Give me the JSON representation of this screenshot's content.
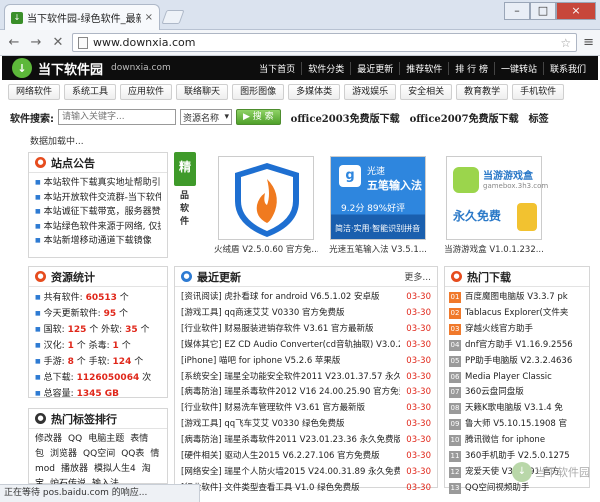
{
  "browser": {
    "tab_title": "当下软件园-绿色软件_最新",
    "tab_close": "×",
    "window_controls": [
      "–",
      "□",
      "×"
    ],
    "url": "www.downxia.com",
    "status_text": "正在等待 pos.baidu.com 的响应..."
  },
  "site": {
    "logo_text": "当下软件园",
    "logo_domain": "downxia.com",
    "top_nav": [
      "当下首页",
      "软件分类",
      "最近更新",
      "推荐软件",
      "排 行 榜",
      "一键转站",
      "联系我们"
    ],
    "categories": [
      "网络软件",
      "系统工具",
      "应用软件",
      "联络聊天",
      "图形图像",
      "多媒体类",
      "游戏娱乐",
      "安全相关",
      "教育教学",
      "手机软件"
    ],
    "search": {
      "label": "软件搜索:",
      "placeholder": "请输入关键字...",
      "select_value": "资源名称",
      "button": "搜 索",
      "hot_links": [
        "office2003免费版下载",
        "office2007免费版下载",
        "标签"
      ]
    },
    "loading_text": "数据加载中..."
  },
  "notice": {
    "title": "站点公告",
    "items": [
      "本站软件下载真实地址帮助引导",
      "本站开放软件交流群-当下软件园",
      "本站诚征下载带宽，服务器赞助",
      "本站绿色软件来源于网络, 仅提供",
      "本站新增移动通道下载镜像"
    ]
  },
  "featured": {
    "badge": "精",
    "caption": "品软件",
    "items": [
      {
        "name": "火绒盾 V2.5.0.60 官方免..."
      },
      {
        "name": "光速五笔输入法 V3.5.1..."
      },
      {
        "name": "当游游戏盒 V1.0.1.232..."
      }
    ],
    "img2_title": "光速",
    "img2_sub": "五笔输入法",
    "img2_stats": "9.2分  89%好评",
    "img2_tags": "简洁·实用·智能识别拼音",
    "img3_title": "当游游戏盒",
    "img3_domain": "gamebox.3h3.com",
    "img3_free": "永久免费"
  },
  "stats": {
    "title": "资源统计",
    "rows": [
      {
        "label": "共有软件:",
        "value": "60513",
        "unit": "个"
      },
      {
        "label": "今天更新软件:",
        "value": "95",
        "unit": "个"
      },
      {
        "label": "国软:",
        "value": "125",
        "unit": "个",
        "label2": "外软:",
        "value2": "35",
        "unit2": "个"
      },
      {
        "label": "汉化:",
        "value": "1",
        "unit": "个",
        "label2": "杀毒:",
        "value2": "1",
        "unit2": "个"
      },
      {
        "label": "手游:",
        "value": "8",
        "unit": "个",
        "label2": "手软:",
        "value2": "124",
        "unit2": "个"
      },
      {
        "label": "总下载:",
        "value": "1126050064",
        "unit": "次"
      },
      {
        "label": "总容量:",
        "value": "1345 GB",
        "unit": ""
      }
    ]
  },
  "latest": {
    "title": "最近更新",
    "more": "更多...",
    "items": [
      {
        "title": "[资讯阅读] 虎扑看球 for android V6.5.1.02 安卓版",
        "date": "03-30"
      },
      {
        "title": "[游戏工具] qq商速艾艾 V0330 官方免费版",
        "date": "03-30"
      },
      {
        "title": "[行业软件] 财易服装进销存软件 V3.61 官方最新版",
        "date": "03-30"
      },
      {
        "title": "[媒体其它] EZ CD Audio Converter(cd音轨抽取) V3.0.2",
        "date": "03-30"
      },
      {
        "title": "[iPhone] 喵吧 for iphone V5.2.6 苹果版",
        "date": "03-30"
      },
      {
        "title": "[系统安全] 瑞星全功能安全软件2011 V23.01.37.57 永久免",
        "date": "03-30"
      },
      {
        "title": "[病毒防治] 瑞星杀毒软件2012 V16 24.00.25.90 官方免费",
        "date": "03-30"
      },
      {
        "title": "[行业软件] 财易洗车管理软件 V3.61 官方最新版",
        "date": "03-30"
      },
      {
        "title": "[游戏工具] qq飞车艾艾 V0330 绿色免费版",
        "date": "03-30"
      },
      {
        "title": "[病毒防治] 瑞星杀毒软件2011 V23.01.23.36 永久免费版",
        "date": "03-30"
      },
      {
        "title": "[硬件相关] 驱动人生2015 V6.2.27.106 官方免费版",
        "date": "03-30"
      },
      {
        "title": "[网络安全] 瑞星个人防火墙2015 V24.00.31.89 永久免费版",
        "date": "03-30"
      },
      {
        "title": "[行业软件] 文件类型查看工具 V1.0 绿色免费版",
        "date": "03-30"
      }
    ]
  },
  "hot": {
    "title": "热门下载",
    "items": [
      {
        "rank": "01",
        "name": "百度魔图电脑版 V3.3.7 pk"
      },
      {
        "rank": "02",
        "name": "Tablacus Explorer(文件夹"
      },
      {
        "rank": "03",
        "name": "穿越火线官方助手"
      },
      {
        "rank": "04",
        "name": "dnf官方助手 V1.16.9.2556"
      },
      {
        "rank": "05",
        "name": "PP助手电脑版 V2.3.2.4636"
      },
      {
        "rank": "06",
        "name": "Media Player Classic"
      },
      {
        "rank": "07",
        "name": "360云盘同盘版"
      },
      {
        "rank": "08",
        "name": "天籁K歌电脑版 V3.1.4 免"
      },
      {
        "rank": "09",
        "name": "鲁大师 V5.10.15.1908 官"
      },
      {
        "rank": "10",
        "name": "腾讯微信 for iphone"
      },
      {
        "rank": "11",
        "name": "360手机助手 V2.5.0.1275"
      },
      {
        "rank": "12",
        "name": "宠爱天使 V3.0.291 官方"
      },
      {
        "rank": "13",
        "name": "QQ空间视频助手"
      }
    ]
  },
  "tags": {
    "title": "热门标签排行",
    "items": [
      "修改器",
      "QQ",
      "电脑主题",
      "表情",
      "包",
      "浏览器",
      "QQ空间",
      "QQ表",
      "情",
      "mod",
      "播放器",
      "模拟人生4",
      "淘",
      "宝",
      "炉石传说",
      "输入法"
    ]
  },
  "watermark": "当下软件园"
}
